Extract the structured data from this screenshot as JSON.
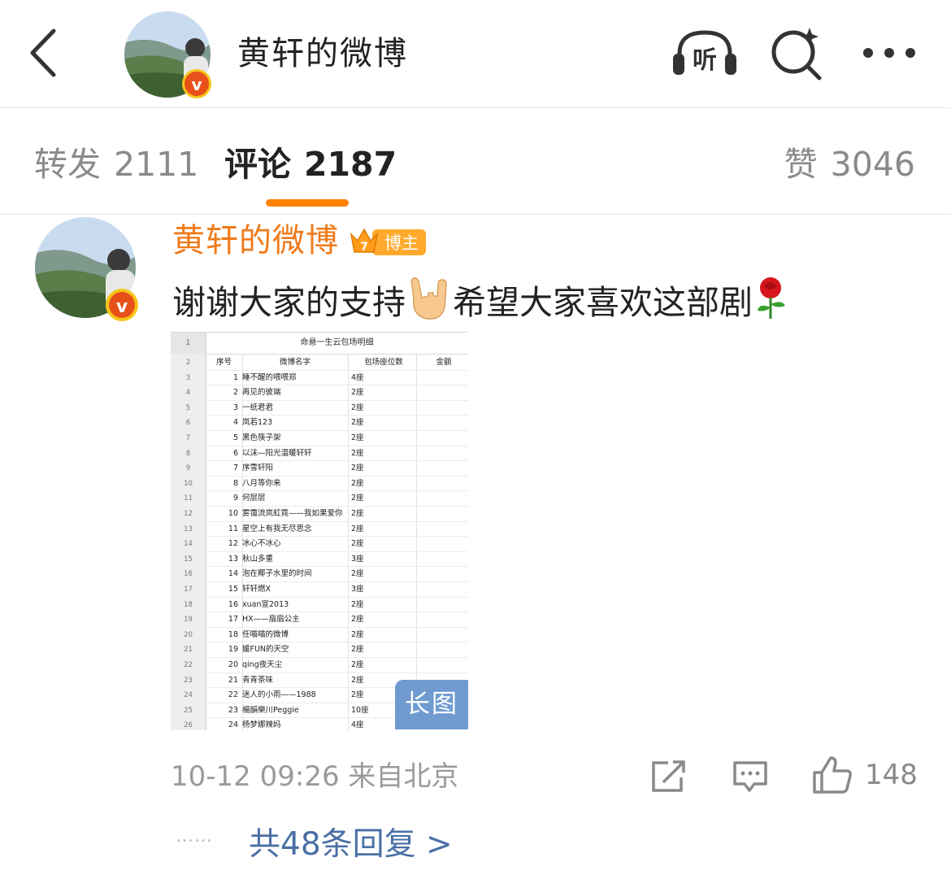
{
  "header": {
    "title": "黄轩的微博",
    "listen_label": "听"
  },
  "tabs": {
    "repost": {
      "label": "转发",
      "count": "2111"
    },
    "comment": {
      "label": "评论",
      "count": "2187"
    },
    "like": {
      "label": "赞",
      "count": "3046"
    }
  },
  "comment": {
    "author": "黄轩的微博",
    "badge": "博主",
    "badge_level": "7",
    "text_part1": "谢谢大家的支持",
    "text_part2": "希望大家喜欢这部剧",
    "emojis": [
      "rock-hand-emoji",
      "rose-emoji"
    ],
    "meta": "10-12 09:26 来自北京",
    "like_count": "148",
    "replies_dots": "……",
    "replies_link": "共48条回复 >"
  },
  "sheet": {
    "title_row_num": "1",
    "title": "命悬一生云包场明细",
    "headers": {
      "row": "2",
      "c1": "序号",
      "c2": "微博名字",
      "c3": "包场座位数",
      "c4": "金额"
    },
    "rows": [
      [
        "3",
        "1",
        "睡不醒的喂喂郑",
        "4座"
      ],
      [
        "4",
        "2",
        "再见的彼端",
        "2座"
      ],
      [
        "5",
        "3",
        "一纸君君",
        "2座"
      ],
      [
        "6",
        "4",
        "岚若123",
        "2座"
      ],
      [
        "7",
        "5",
        "黑色筷子架",
        "2座"
      ],
      [
        "8",
        "6",
        "以沫—阳光温暖轩轩",
        "2座"
      ],
      [
        "9",
        "7",
        "序雪轩阳",
        "2座"
      ],
      [
        "10",
        "8",
        "八月等你来",
        "2座"
      ],
      [
        "11",
        "9",
        "何层层",
        "2座"
      ],
      [
        "12",
        "10",
        "雾霭流岚虹霓——我如果爱你",
        "2座"
      ],
      [
        "13",
        "11",
        "星空上有我无尽思念",
        "2座"
      ],
      [
        "14",
        "12",
        "冰心不冰心",
        "2座"
      ],
      [
        "15",
        "13",
        "秋山多重",
        "3座"
      ],
      [
        "16",
        "14",
        "泡在椰子水里的时间",
        "2座"
      ],
      [
        "17",
        "15",
        "轩轩燃X",
        "3座"
      ],
      [
        "18",
        "16",
        "xuan宣2013",
        "2座"
      ],
      [
        "19",
        "17",
        "HX——扇扇公主",
        "2座"
      ],
      [
        "20",
        "18",
        "任喵喵的微博",
        "2座"
      ],
      [
        "21",
        "19",
        "媛FUN的天空",
        "2座"
      ],
      [
        "22",
        "20",
        "qing夜天尘",
        "2座"
      ],
      [
        "23",
        "21",
        "青青茶味",
        "2座"
      ],
      [
        "24",
        "22",
        "迷人的小雨——1988",
        "2座"
      ],
      [
        "25",
        "23",
        "楊韻樂川Peggie",
        "10座"
      ],
      [
        "26",
        "24",
        "杨梦娜辣妈",
        "4座"
      ]
    ],
    "long_image_label": "长图"
  },
  "colors": {
    "accent": "#ff8200",
    "author_name": "#f07a1a",
    "link": "#4a6fa5",
    "long_image_badge": "#6f9bd1"
  }
}
